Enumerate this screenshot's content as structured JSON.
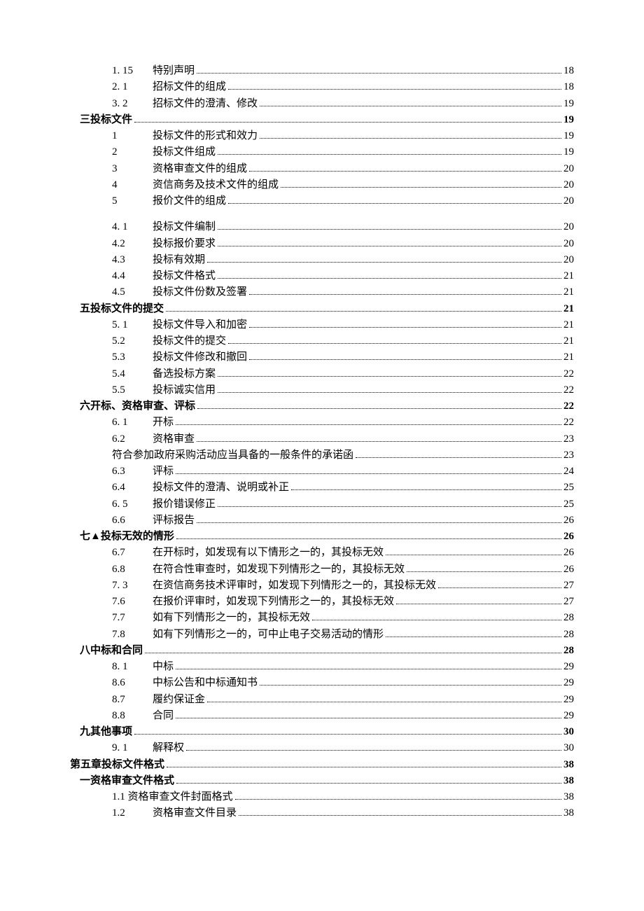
{
  "toc": [
    {
      "level": "entry",
      "num": "1.  15",
      "title": "特别声明",
      "page": "18"
    },
    {
      "level": "entry",
      "num": "2.   1",
      "title": "招标文件的组成",
      "page": "18"
    },
    {
      "level": "entry",
      "num": "3.   2",
      "title": "招标文件的澄清、修改",
      "page": "19"
    },
    {
      "level": "sub",
      "num": "",
      "title": "三投标文件",
      "page": "19"
    },
    {
      "level": "entry",
      "num": "1",
      "title": "投标文件的形式和效力",
      "page": "19"
    },
    {
      "level": "entry",
      "num": "2",
      "title": "投标文件组成",
      "page": "19"
    },
    {
      "level": "entry",
      "num": "3",
      "title": "资格审查文件的组成",
      "page": "20"
    },
    {
      "level": "entry",
      "num": "4",
      "title": "资信商务及技术文件的组成",
      "page": "20"
    },
    {
      "level": "entry",
      "num": "5",
      "title": "报价文件的组成",
      "page": "20"
    },
    {
      "level": "gap"
    },
    {
      "level": "entry",
      "num": "4.   1",
      "title": "投标文件编制",
      "page": "20"
    },
    {
      "level": "entry",
      "num": "4.2",
      "title": "投标报价要求",
      "page": "20"
    },
    {
      "level": "entry",
      "num": "4.3",
      "title": "投标有效期",
      "page": "20"
    },
    {
      "level": "entry",
      "num": "4.4",
      "title": "投标文件格式",
      "page": "21"
    },
    {
      "level": "entry",
      "num": "4.5",
      "title": "投标文件份数及签署",
      "page": "21"
    },
    {
      "level": "sub",
      "num": "",
      "title": "五投标文件的提交",
      "page": "21"
    },
    {
      "level": "entry",
      "num": "5.   1",
      "title": "投标文件导入和加密",
      "page": "21"
    },
    {
      "level": "entry",
      "num": "5.2",
      "title": "投标文件的提交",
      "page": "21"
    },
    {
      "level": "entry",
      "num": "5.3",
      "title": "投标文件修改和撤回",
      "page": "21"
    },
    {
      "level": "entry",
      "num": "5.4",
      "title": "备选投标方案",
      "page": "22"
    },
    {
      "level": "entry",
      "num": "5.5",
      "title": "投标诚实信用",
      "page": "22"
    },
    {
      "level": "sub",
      "num": "",
      "title": "六开标、资格审查、评标",
      "page": "22"
    },
    {
      "level": "entry",
      "num": "6.   1",
      "title": "开标",
      "page": "22"
    },
    {
      "level": "entry",
      "num": "6.2",
      "title": "资格审查",
      "page": "23"
    },
    {
      "level": "long",
      "num": "",
      "title": "符合参加政府采购活动应当具备的一般条件的承诺函",
      "page": "23"
    },
    {
      "level": "entry",
      "num": "6.3",
      "title": "评标",
      "page": "24"
    },
    {
      "level": "entry",
      "num": "6.4",
      "title": "投标文件的澄清、说明或补正",
      "page": "25"
    },
    {
      "level": "entry",
      "num": "6.   5",
      "title": "报价错误修正",
      "page": "25"
    },
    {
      "level": "entry",
      "num": "6.6",
      "title": "评标报告",
      "page": "26"
    },
    {
      "level": "sub",
      "num": "",
      "title": "七▲投标无效的情形",
      "page": "26"
    },
    {
      "level": "entry",
      "num": "6.7",
      "title": "在开标时，如发现有以下情形之一的，其投标无效",
      "page": "26"
    },
    {
      "level": "entry",
      "num": "6.8",
      "title": "在符合性审查时，如发现下列情形之一的，其投标无效",
      "page": "26"
    },
    {
      "level": "entry",
      "num": "7.   3",
      "title": "在资信商务技术评审时，如发现下列情形之一的，其投标无效",
      "page": "27"
    },
    {
      "level": "entry",
      "num": "7.6",
      "title": "在报价评审时，如发现下列情形之一的，其投标无效",
      "page": "27"
    },
    {
      "level": "entry",
      "num": "7.7",
      "title": "如有下列情形之一的，其投标无效",
      "page": "28"
    },
    {
      "level": "entry",
      "num": "7.8",
      "title": "如有下列情形之一的，可中止电子交易活动的情形",
      "page": "28"
    },
    {
      "level": "sub",
      "num": "",
      "title": "八中标和合同",
      "page": "28"
    },
    {
      "level": "entry",
      "num": "8.   1",
      "title": "中标",
      "page": "29"
    },
    {
      "level": "entry",
      "num": "8.6",
      "title": "中标公告和中标通知书",
      "page": "29"
    },
    {
      "level": "entry",
      "num": "8.7",
      "title": "履约保证金",
      "page": "29"
    },
    {
      "level": "entry",
      "num": "8.8",
      "title": "合同",
      "page": "29"
    },
    {
      "level": "sub",
      "num": "",
      "title": "九其他事项",
      "page": "30"
    },
    {
      "level": "entry",
      "num": "9.   1",
      "title": "解释权",
      "page": "30"
    },
    {
      "level": "section",
      "num": "",
      "title": "第五章投标文件格式",
      "page": "38"
    },
    {
      "level": "sub",
      "num": "",
      "title": "一资格审查文件格式",
      "page": "38"
    },
    {
      "level": "long",
      "num": "",
      "title": "1.1 资格审查文件封面格式",
      "page": "38"
    },
    {
      "level": "entry",
      "num": "1.2",
      "title": "资格审查文件目录",
      "page": "38"
    }
  ]
}
